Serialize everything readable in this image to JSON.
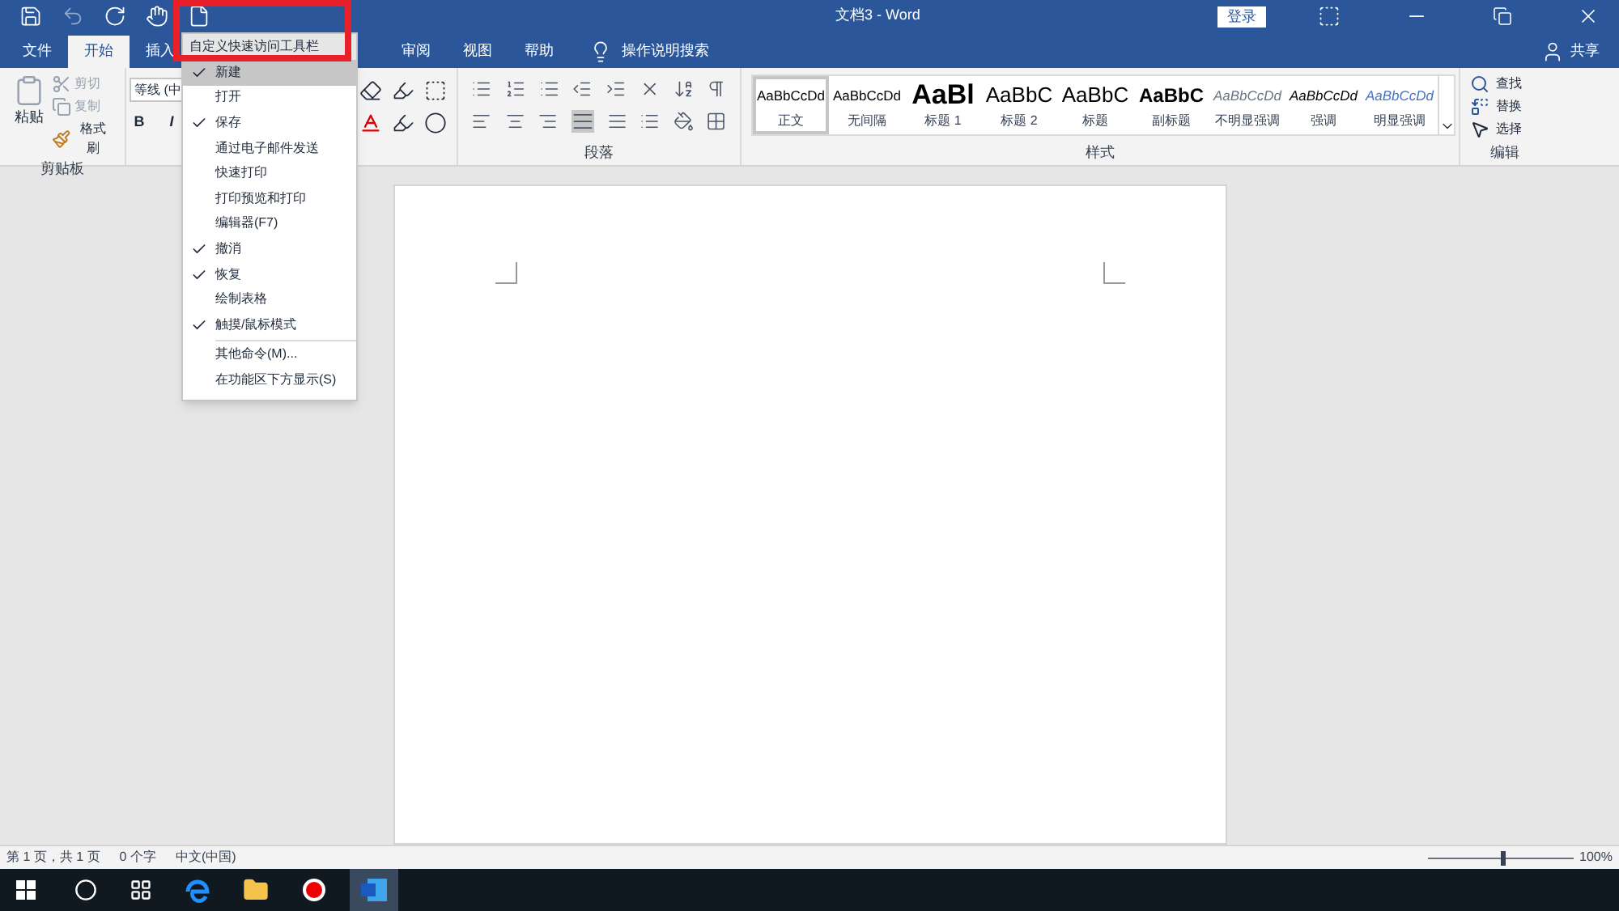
{
  "window": {
    "title": "文档3 - Word",
    "sign_in": "登录"
  },
  "tabs": [
    {
      "label": "文件",
      "selected": false
    },
    {
      "label": "开始",
      "selected": true
    },
    {
      "label": "插入",
      "selected": false
    },
    {
      "label": "审阅",
      "selected": false
    },
    {
      "label": "视图",
      "selected": false
    },
    {
      "label": "帮助",
      "selected": false
    }
  ],
  "tell_me": "操作说明搜索",
  "share": "共享",
  "clipboard": {
    "paste": "粘贴",
    "cut": "剪切",
    "copy": "复制",
    "format_painter": "格式刷",
    "label": "剪贴板"
  },
  "font": {
    "name": "等线 (中",
    "bold": "B",
    "italic": "I"
  },
  "paragraph": {
    "label": "段落"
  },
  "styles": {
    "label": "样式",
    "items": [
      {
        "preview": "AaBbCcDd",
        "label": "正文",
        "kind": "body",
        "selected": true
      },
      {
        "preview": "AaBbCcDd",
        "label": "无间隔",
        "kind": "body",
        "selected": false
      },
      {
        "preview": "AaBl",
        "label": "标题 1",
        "kind": "h1",
        "selected": false
      },
      {
        "preview": "AaBbC",
        "label": "标题 2",
        "kind": "h2",
        "selected": false
      },
      {
        "preview": "AaBbC",
        "label": "标题",
        "kind": "title",
        "selected": false
      },
      {
        "preview": "AaBbC",
        "label": "副标题",
        "kind": "subtitle",
        "selected": false
      },
      {
        "preview": "AaBbCcDd",
        "label": "不明显强调",
        "kind": "subtle",
        "selected": false
      },
      {
        "preview": "AaBbCcDd",
        "label": "强调",
        "kind": "emphasis",
        "selected": false
      },
      {
        "preview": "AaBbCcDd",
        "label": "明显强调",
        "kind": "intense",
        "selected": false
      }
    ]
  },
  "editing": {
    "find": "查找",
    "replace": "替换",
    "select": "选择",
    "label": "编辑"
  },
  "qat_menu": {
    "title": "自定义快速访问工具栏",
    "items": [
      {
        "label": "新建",
        "checked": true,
        "selected": true
      },
      {
        "label": "打开",
        "checked": false,
        "selected": false
      },
      {
        "label": "保存",
        "checked": true,
        "selected": false
      },
      {
        "label": "通过电子邮件发送",
        "checked": false,
        "selected": false
      },
      {
        "label": "快速打印",
        "checked": false,
        "selected": false
      },
      {
        "label": "打印预览和打印",
        "checked": false,
        "selected": false
      },
      {
        "label": "编辑器(F7)",
        "checked": false,
        "selected": false
      },
      {
        "label": "撤消",
        "checked": true,
        "selected": false
      },
      {
        "label": "恢复",
        "checked": true,
        "selected": false
      },
      {
        "label": "绘制表格",
        "checked": false,
        "selected": false
      },
      {
        "label": "触摸/鼠标模式",
        "checked": true,
        "selected": false
      }
    ],
    "more": [
      "其他命令(M)...",
      "在功能区下方显示(S)"
    ]
  },
  "status_bar": {
    "page": "第 1 页，共 1 页",
    "words": "0 个字",
    "language": "中文(中国)",
    "zoom": "100%",
    "zoom_level": {
      "level": 0.5
    }
  }
}
